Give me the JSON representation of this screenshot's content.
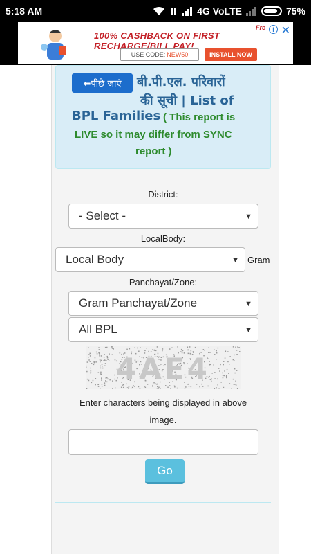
{
  "status_bar": {
    "time": "5:18 AM",
    "network": "4G VoLTE",
    "battery": "75%"
  },
  "ad": {
    "headline": "100% CASHBACK ON FIRST RECHARGE/BILL PAY!",
    "code_prefix": "USE CODE:",
    "code": "NEW50",
    "install_label": "INSTALL NOW",
    "brand": "Fre",
    "info_icon": "i",
    "close_icon": "✕"
  },
  "panel": {
    "back_label": "⬅पीछे जाएं",
    "title_line1": "बी.पी.एल. परिवारों",
    "title_line2": "की सूची | List of",
    "title_line3": "BPL Families",
    "note_line1": "( This report is",
    "note_line2": "LIVE so it may differ from SYNC",
    "note_line3": "report )"
  },
  "form": {
    "district_label": "District:",
    "district_value": "- Select -",
    "localbody_label": "LocalBody:",
    "localbody_value": "Local Body",
    "gram_label": "Gram",
    "panchayat_label": "Panchayat/Zone:",
    "panchayat_value": "Gram Panchayat/Zone",
    "bpl_value": "All BPL",
    "captcha_text": "4AE4",
    "help_line1": "Enter characters being displayed in above",
    "help_line2": "image.",
    "captcha_input_value": "",
    "go_label": "Go"
  },
  "colors": {
    "panel_bg": "#d9edf7",
    "title_blue": "#2a6496",
    "note_green": "#2e8b2e",
    "back_button": "#1c6dcc",
    "go_button": "#5bc0de"
  }
}
